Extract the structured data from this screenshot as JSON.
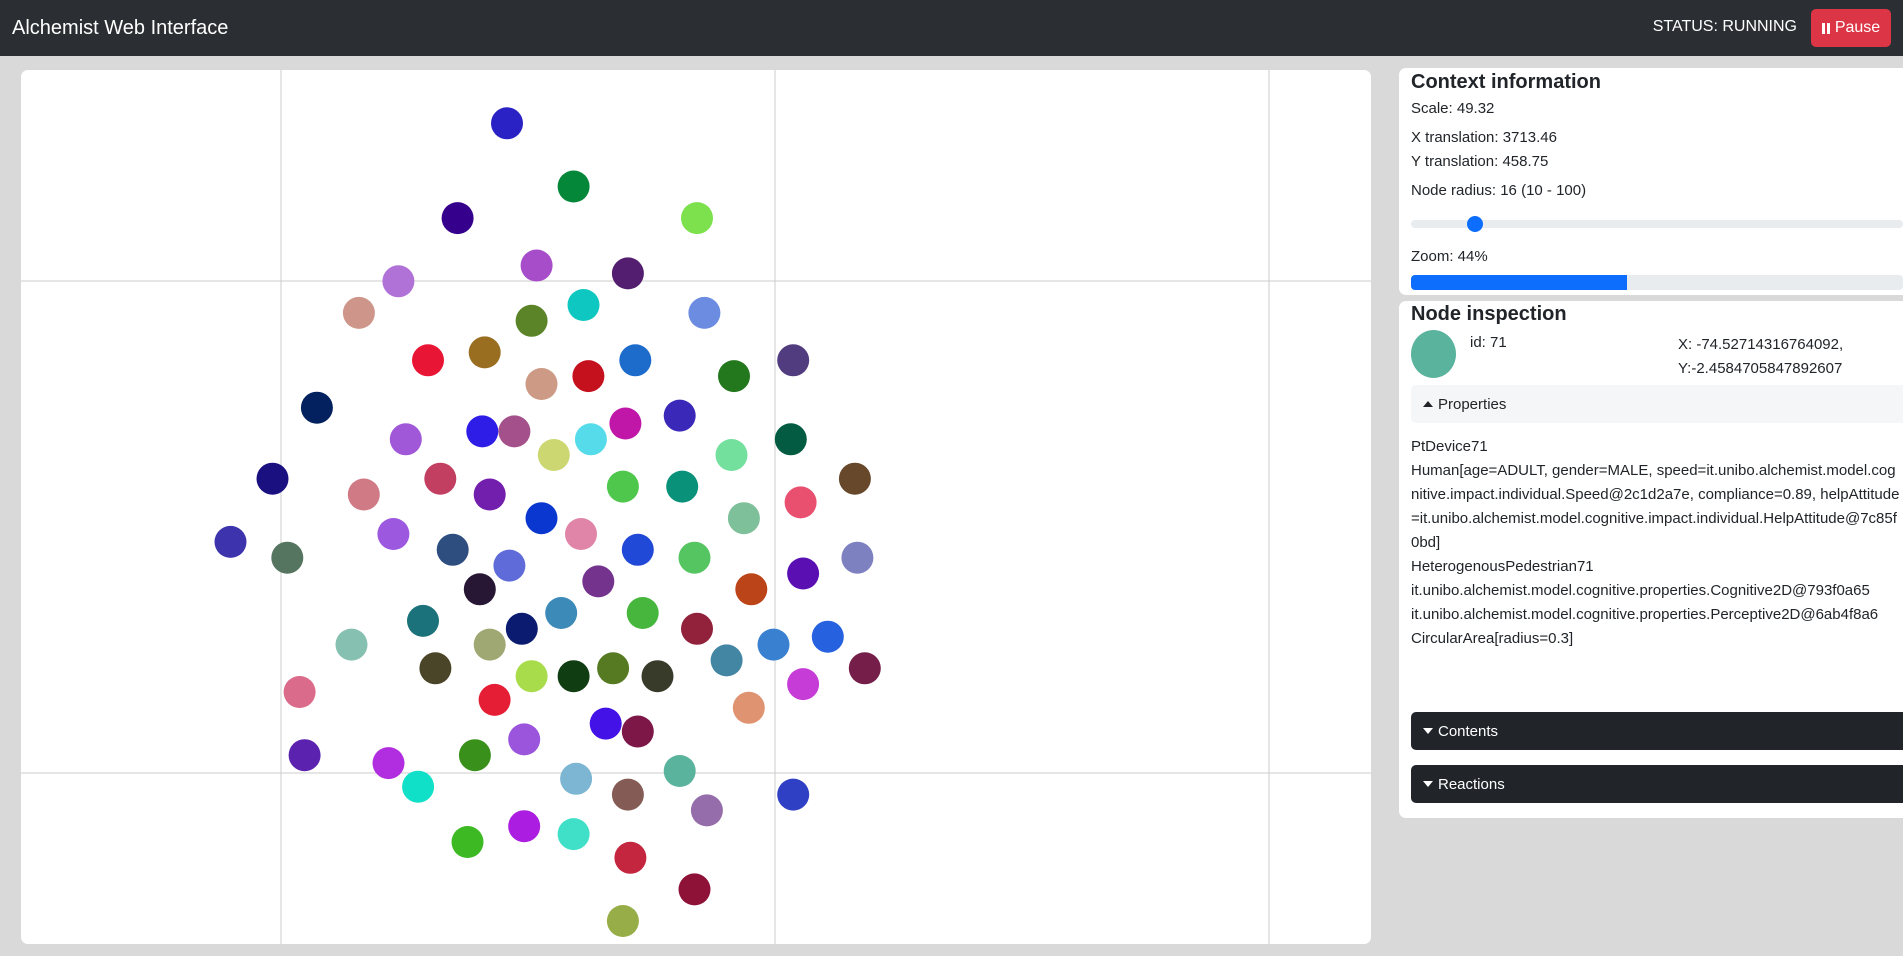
{
  "header": {
    "title": "Alchemist Web Interface",
    "status": "STATUS: RUNNING",
    "pause_label": "Pause"
  },
  "context": {
    "title": "Context information",
    "scale": "Scale: 49.32",
    "x_translation": "X translation: 3713.46",
    "y_translation": "Y translation: 458.75",
    "node_radius_label": "Node radius: 16 (10 - 100)",
    "node_radius_value": 16,
    "node_radius_min": 10,
    "node_radius_max": 100,
    "zoom_label": "Zoom: 44%",
    "zoom_percent": 44
  },
  "inspection": {
    "title": "Node inspection",
    "id_label": "id: 71",
    "x_label": "X: -74.52714316764092,",
    "y_label": "Y:-2.4584705847892607",
    "node_color": "#5ab39d",
    "properties_label": "Properties",
    "properties": [
      "PtDevice71",
      "Human[age=ADULT, gender=MALE, speed=it.unibo.alchemist.model.cognitive.impact.individual.Speed@2c1d2a7e, compliance=0.89, helpAttitude=it.unibo.alchemist.model.cognitive.impact.individual.HelpAttitude@7c85f0bd]",
      "HeterogenousPedestrian71",
      "it.unibo.alchemist.model.cognitive.properties.Cognitive2D@793f0a65",
      "it.unibo.alchemist.model.cognitive.properties.Perceptive2D@6ab4f8a6",
      "CircularArea[radius=0.3]"
    ],
    "contents_label": "Contents",
    "reactions_label": "Reactions"
  },
  "colors": {
    "topbar": "#2b2f33",
    "danger": "#dc3545",
    "primary": "#0d6efd",
    "dark": "#212529"
  },
  "nodes": [
    {
      "color": "#3d33ad",
      "x": -84.8,
      "y": -3.3
    },
    {
      "color": "#1a1080",
      "x": -83.1,
      "y": -2.5
    },
    {
      "color": "#557560",
      "x": -82.5,
      "y": -3.5
    },
    {
      "color": "#03215e",
      "x": -81.3,
      "y": -1.6
    },
    {
      "color": "#da6b8b",
      "x": -82.0,
      "y": -5.2
    },
    {
      "color": "#5b22b0",
      "x": -81.8,
      "y": -6.0
    },
    {
      "color": "#ce958a",
      "x": -79.6,
      "y": -0.4
    },
    {
      "color": "#d07a86",
      "x": -79.4,
      "y": -2.7
    },
    {
      "color": "#86c0b0",
      "x": -79.9,
      "y": -4.6
    },
    {
      "color": "#b072d6",
      "x": -78.0,
      "y": 0.0
    },
    {
      "color": "#a158d8",
      "x": -77.7,
      "y": -2.0
    },
    {
      "color": "#9c59e0",
      "x": -78.2,
      "y": -3.2
    },
    {
      "color": "#b12de0",
      "x": -78.4,
      "y": -6.1
    },
    {
      "color": "#e81634",
      "x": -76.8,
      "y": -1.0
    },
    {
      "color": "#c23f62",
      "x": -76.3,
      "y": -2.5
    },
    {
      "color": "#1b727a",
      "x": -77.0,
      "y": -4.3
    },
    {
      "color": "#4a4428",
      "x": -76.5,
      "y": -4.9
    },
    {
      "color": "#11e0c8",
      "x": -77.2,
      "y": -6.4
    },
    {
      "color": "#34008c",
      "x": -75.6,
      "y": 0.8
    },
    {
      "color": "#2e4e80",
      "x": -75.8,
      "y": -3.4
    },
    {
      "color": "#2e1de6",
      "x": -74.6,
      "y": -1.9
    },
    {
      "color": "#996e21",
      "x": -74.5,
      "y": -0.9
    },
    {
      "color": "#731fae",
      "x": -74.3,
      "y": -2.7
    },
    {
      "color": "#281734",
      "x": -74.7,
      "y": -3.9
    },
    {
      "color": "#9fa772",
      "x": -74.3,
      "y": -4.6
    },
    {
      "color": "#e51e36",
      "x": -74.1,
      "y": -5.3
    },
    {
      "color": "#39911c",
      "x": -74.9,
      "y": -6.0
    },
    {
      "color": "#3db924",
      "x": -75.2,
      "y": -7.1
    },
    {
      "color": "#2a22c4",
      "x": -73.6,
      "y": 2.0
    },
    {
      "color": "#a4508a",
      "x": -73.3,
      "y": -1.9
    },
    {
      "color": "#5f6bd8",
      "x": -73.5,
      "y": -3.6
    },
    {
      "color": "#ab1de0",
      "x": -72.9,
      "y": -6.9
    },
    {
      "color": "#a74dca",
      "x": -72.4,
      "y": 0.2
    },
    {
      "color": "#5b8429",
      "x": -72.6,
      "y": -0.5
    },
    {
      "color": "#cd9a85",
      "x": -72.2,
      "y": -1.3
    },
    {
      "color": "#0b1b70",
      "x": -73.0,
      "y": -4.4
    },
    {
      "color": "#0a37cf",
      "x": -72.2,
      "y": -3.0
    },
    {
      "color": "#a8dc4b",
      "x": -72.6,
      "y": -5.0
    },
    {
      "color": "#9a55dc",
      "x": -72.9,
      "y": -5.8
    },
    {
      "color": "#ccd772",
      "x": -71.7,
      "y": -2.2
    },
    {
      "color": "#05873a",
      "x": -70.9,
      "y": 1.2
    },
    {
      "color": "#0ec7c0",
      "x": -70.5,
      "y": -0.3
    },
    {
      "color": "#c5101d",
      "x": -70.3,
      "y": -1.2
    },
    {
      "color": "#55dbe9",
      "x": -70.2,
      "y": -2.0
    },
    {
      "color": "#e085a7",
      "x": -70.6,
      "y": -3.2
    },
    {
      "color": "#3c8ab8",
      "x": -71.4,
      "y": -4.2
    },
    {
      "color": "#113d12",
      "x": -70.9,
      "y": -5.0
    },
    {
      "color": "#7cb6d2",
      "x": -70.8,
      "y": -6.3
    },
    {
      "color": "#3fe0c7",
      "x": -70.9,
      "y": -7.0
    },
    {
      "color": "#74338d",
      "x": -69.9,
      "y": -3.8
    },
    {
      "color": "#4312e6",
      "x": -69.6,
      "y": -5.6
    },
    {
      "color": "#567a22",
      "x": -69.3,
      "y": -4.9
    },
    {
      "color": "#97ad48",
      "x": -68.9,
      "y": -8.1
    },
    {
      "color": "#4fc74d",
      "x": -68.9,
      "y": -2.6
    },
    {
      "color": "#541e70",
      "x": -68.7,
      "y": 0.1
    },
    {
      "color": "#1d6ccc",
      "x": -68.4,
      "y": -1.0
    },
    {
      "color": "#c017a9",
      "x": -68.8,
      "y": -1.8
    },
    {
      "color": "#1f49d6",
      "x": -68.3,
      "y": -3.4
    },
    {
      "color": "#46b63c",
      "x": -68.1,
      "y": -4.2
    },
    {
      "color": "#7c1747",
      "x": -68.3,
      "y": -5.7
    },
    {
      "color": "#845c55",
      "x": -68.7,
      "y": -6.5
    },
    {
      "color": "#c42640",
      "x": -68.6,
      "y": -7.3
    },
    {
      "color": "#383b2a",
      "x": -67.5,
      "y": -5.0
    },
    {
      "color": "#099279",
      "x": -66.5,
      "y": -2.6
    },
    {
      "color": "#3a29b9",
      "x": -66.6,
      "y": -1.7
    },
    {
      "color": "#7de14d",
      "x": -65.9,
      "y": 0.8
    },
    {
      "color": "#6c8ce2",
      "x": -65.6,
      "y": -0.4
    },
    {
      "color": "#55c561",
      "x": -66.0,
      "y": -3.5
    },
    {
      "color": "#92213c",
      "x": -65.9,
      "y": -4.4
    },
    {
      "color": "#5ab39d",
      "x": -66.6,
      "y": -6.2
    },
    {
      "color": "#956daa",
      "x": -65.5,
      "y": -6.7
    },
    {
      "color": "#8e1238",
      "x": -66.0,
      "y": -7.7
    },
    {
      "color": "#23781e",
      "x": -64.4,
      "y": -1.2
    },
    {
      "color": "#73e09d",
      "x": -64.5,
      "y": -2.2
    },
    {
      "color": "#7ec09a",
      "x": -64.0,
      "y": -3.0
    },
    {
      "color": "#4386a3",
      "x": -64.7,
      "y": -4.8
    },
    {
      "color": "#bb4418",
      "x": -63.7,
      "y": -3.9
    },
    {
      "color": "#e09370",
      "x": -63.8,
      "y": -5.4
    },
    {
      "color": "#3a80d1",
      "x": -62.8,
      "y": -4.6
    },
    {
      "color": "#523c80",
      "x": -62.0,
      "y": -1.0
    },
    {
      "color": "#035c42",
      "x": -62.1,
      "y": -2.0
    },
    {
      "color": "#e9506f",
      "x": -61.7,
      "y": -2.8
    },
    {
      "color": "#5a0fb3",
      "x": -61.6,
      "y": -3.7
    },
    {
      "color": "#c63cd6",
      "x": -61.6,
      "y": -5.1
    },
    {
      "color": "#3040c4",
      "x": -62.0,
      "y": -6.5
    },
    {
      "color": "#2661e0",
      "x": -60.6,
      "y": -4.5
    },
    {
      "color": "#67482b",
      "x": -59.5,
      "y": -2.5
    },
    {
      "color": "#7e81c0",
      "x": -59.4,
      "y": -3.5
    },
    {
      "color": "#751e49",
      "x": -59.1,
      "y": -4.9
    }
  ]
}
